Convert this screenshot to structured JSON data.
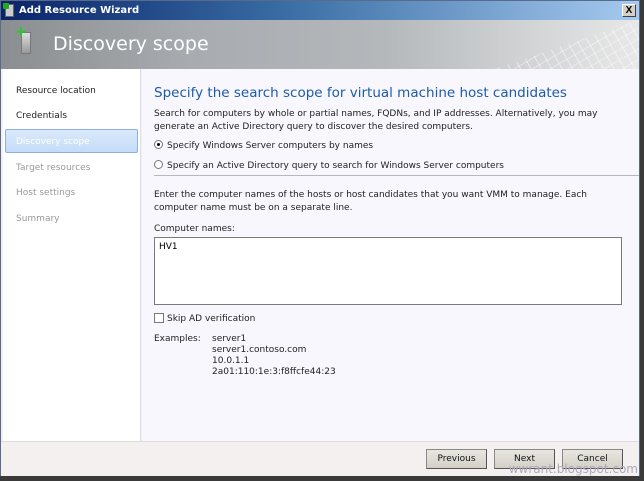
{
  "window": {
    "title": "Add Resource Wizard",
    "close_label": "X"
  },
  "banner": {
    "title": "Discovery scope"
  },
  "sidebar": {
    "items": [
      {
        "label": "Resource location",
        "state": "done"
      },
      {
        "label": "Credentials",
        "state": "done"
      },
      {
        "label": "Discovery scope",
        "state": "active"
      },
      {
        "label": "Target resources",
        "state": "todo"
      },
      {
        "label": "Host settings",
        "state": "todo"
      },
      {
        "label": "Summary",
        "state": "todo"
      }
    ]
  },
  "main": {
    "heading": "Specify the search scope for virtual machine host candidates",
    "intro": "Search for computers by whole or partial names, FQDNs, and IP addresses. Alternatively, you may generate an Active Directory query to discover the desired computers.",
    "radio_names": "Specify Windows Server computers by names",
    "radio_ad": "Specify an Active Directory query to search for Windows Server computers",
    "instructions": "Enter the computer names of the hosts or host candidates that you want VMM to manage. Each computer name must be on a separate line.",
    "computer_names_label": "Computer names:",
    "computer_names_value": "HV1",
    "skip_ad": "Skip AD verification",
    "examples_label": "Examples:",
    "examples": [
      "server1",
      "server1.contoso.com",
      "10.0.1.1",
      "2a01:110:1e:3:f8ffcfe44:23"
    ]
  },
  "footer": {
    "previous": "Previous",
    "next": "Next",
    "cancel": "Cancel"
  },
  "watermark": "wwrant.blogspot.com"
}
